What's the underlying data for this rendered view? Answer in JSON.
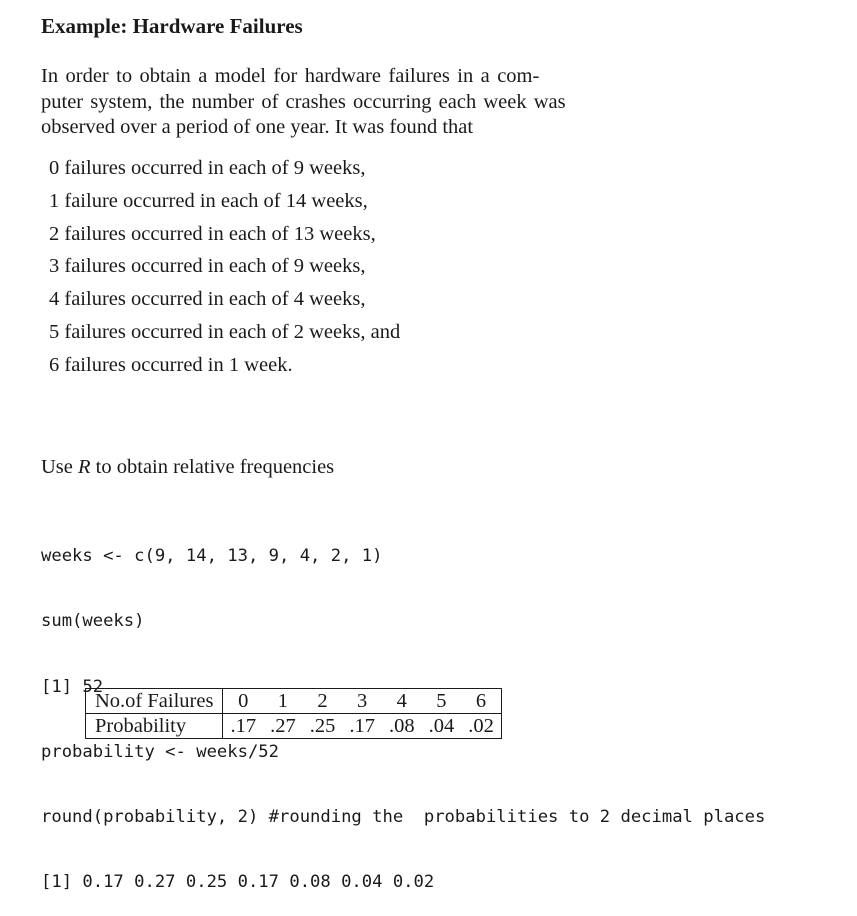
{
  "title": "Example: Hardware Failures",
  "intro_lines": [
    "In order to obtain a model for hardware failures in a com-",
    "puter system, the number of crashes occurring each week was",
    "observed over a period of one year. It was found that"
  ],
  "items": [
    "0 failures occurred in each of 9 weeks,",
    "1 failure occurred in each of 14 weeks,",
    "2 failures occurred in each of 13 weeks,",
    "3 failures occurred in each of 9 weeks,",
    "4 failures occurred in each of 4 weeks,",
    "5 failures occurred in each of 2 weeks, and",
    "6 failures occurred in 1 week."
  ],
  "use_r": {
    "before": "Use ",
    "r": "R",
    "after": " to obtain relative frequencies"
  },
  "code_lines": [
    "weeks <- c(9, 14, 13, 9, 4, 2, 1)",
    "sum(weeks)",
    "[1] 52",
    "probability <- weeks/52",
    "round(probability, 2) #rounding the  probabilities to 2 decimal places",
    "[1] 0.17 0.27 0.25 0.17 0.08 0.04 0.02"
  ],
  "table": {
    "row1_header": "No.of Failures",
    "row2_header": "Probability",
    "failures": [
      "0",
      "1",
      "2",
      "3",
      "4",
      "5",
      "6"
    ],
    "probabilities": [
      ".17",
      ".27",
      ".25",
      ".17",
      ".08",
      ".04",
      ".02"
    ]
  }
}
